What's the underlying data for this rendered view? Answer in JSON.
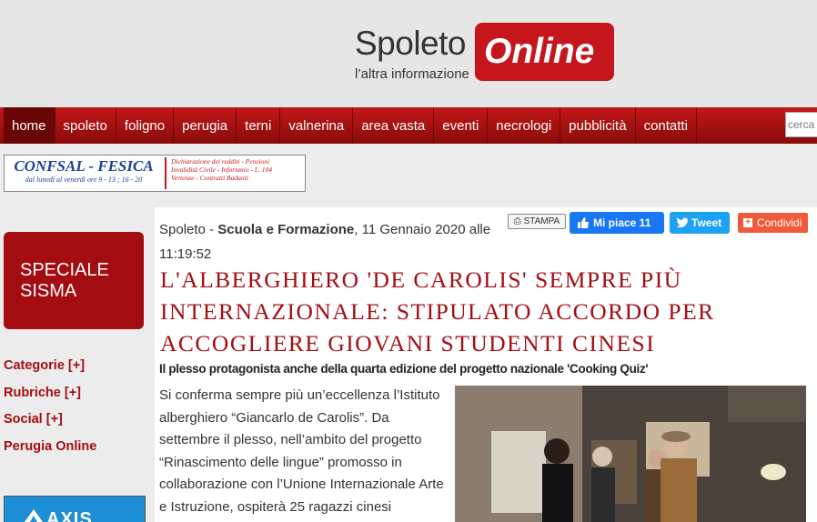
{
  "header": {
    "logo_word": "Spoleto",
    "logo_box": "Online",
    "tagline": "l’altra informazione"
  },
  "nav": {
    "items": [
      {
        "label": "home",
        "active": true
      },
      {
        "label": "spoleto"
      },
      {
        "label": "foligno"
      },
      {
        "label": "perugia"
      },
      {
        "label": "terni"
      },
      {
        "label": "valnerina"
      },
      {
        "label": "area vasta"
      },
      {
        "label": "eventi"
      },
      {
        "label": "necrologi"
      },
      {
        "label": "pubblicità"
      },
      {
        "label": "contatti"
      }
    ],
    "search_placeholder": "cerca"
  },
  "banner": {
    "brand": "CONFSAL - FESICA",
    "hours": "dal lunedì al venerdì ore 9 - 13 ; 16 - 20",
    "line1": "Dichiarazione dei redditi - Pensioni",
    "line2": "Invalidità Civile - Infortunio - L. 104",
    "line3": "Vertenze - Contratti Badanti"
  },
  "sidebar": {
    "speciale": "SPECIALE SISMA",
    "links": [
      "Categorie [+]",
      "Rubriche [+]",
      "Social [+]",
      "Perugia Online"
    ],
    "axis_label": "AXIS"
  },
  "article": {
    "city": "Spoleto",
    "category": "Scuola e Formazione",
    "date": ", 11 Gennaio 2020 alle",
    "time": "11:19:52",
    "stampa": "STAMPA",
    "like": "Mi piace 11",
    "tweet": "Tweet",
    "share": "Condividi",
    "title": "L'ALBERGHIERO 'DE CAROLIS' SEMPRE PIÙ INTERNAZIONALE: STIPULATO ACCORDO PER ACCOGLIERE GIOVANI STUDENTI CINESI",
    "subtitle": "Il plesso protagonista anche della quarta edizione del progetto nazionale 'Cooking Quiz'",
    "body": "Si conferma sempre più un’eccellenza l’Istituto alberghiero “Giancarlo de Carolis”. Da settembre il plesso, nell’ambito del progetto “Rinascimento delle lingue” promosso in collaborazione con l’Unione Internazionale Arte e Istruzione, ospiterà 25 ragazzi cinesi"
  },
  "colors": {
    "brand_red": "#c4161c",
    "title_red": "#a30d12",
    "facebook": "#1877f2",
    "twitter": "#1da1f2",
    "share": "#ef5a3b"
  }
}
